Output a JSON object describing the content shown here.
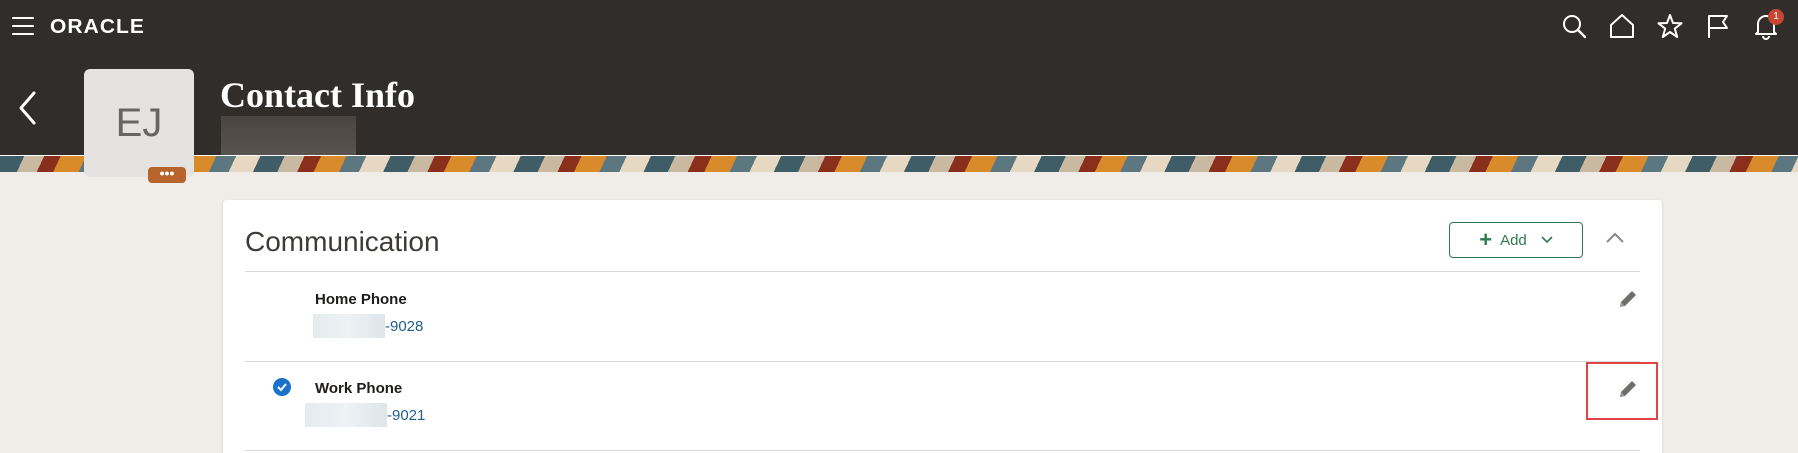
{
  "brand": {
    "logo": "ORACLE"
  },
  "header": {
    "page_title": "Contact Info",
    "avatar_initials": "EJ",
    "avatar_more": "•••",
    "notification_count": "1"
  },
  "icons": {
    "menu": "hamburger-menu-icon",
    "search": "search-icon",
    "home": "home-icon",
    "favorites": "star-icon",
    "flag": "flag-icon",
    "notifications": "bell-icon",
    "back": "chevron-left-icon"
  },
  "card": {
    "title": "Communication",
    "add_label": "Add",
    "rows": [
      {
        "label": "Home Phone",
        "value": "-9028",
        "primary": false
      },
      {
        "label": "Work Phone",
        "value": "-9021",
        "primary": true
      }
    ]
  },
  "colors": {
    "topbar": "#312d2a",
    "accent_green": "#2f7a4d",
    "link_blue": "#1f5f8b",
    "badge_red": "#c74634",
    "check_blue": "#1a73c9",
    "highlight_red": "#e04545"
  }
}
